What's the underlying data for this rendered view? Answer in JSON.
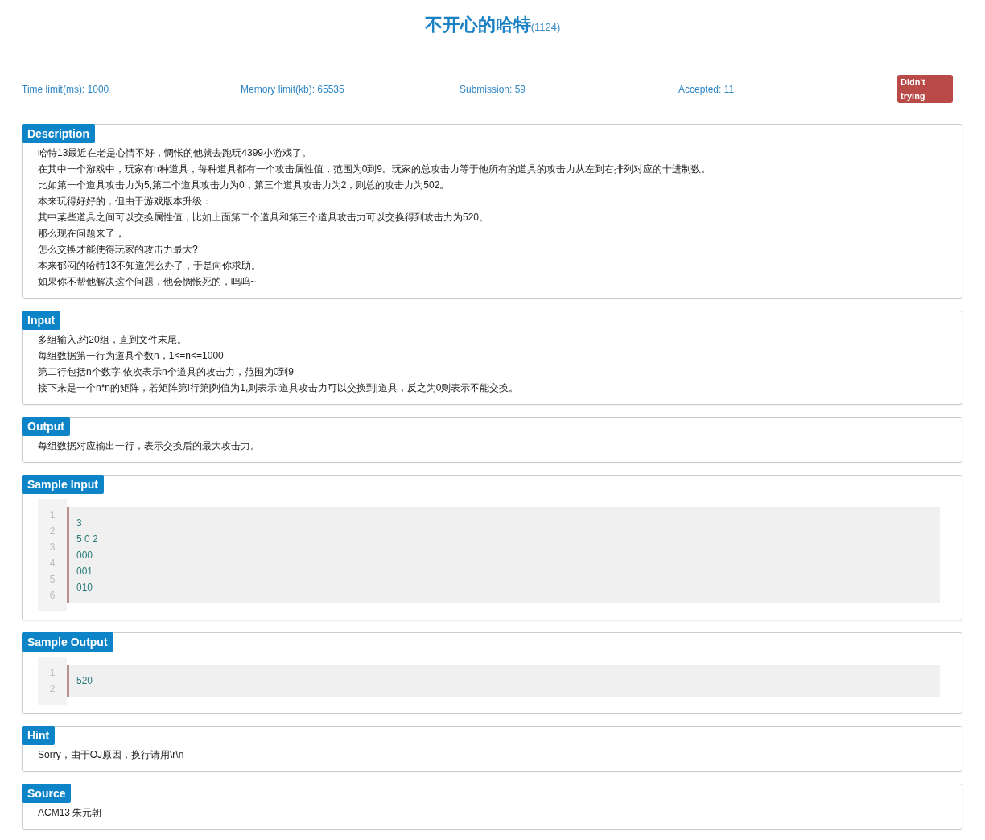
{
  "problem": {
    "title": "不开心的哈特",
    "id": "(1124)"
  },
  "stats": [
    {
      "label": "Time limit(ms): 1000"
    },
    {
      "label": "Memory limit(kb): 65535"
    },
    {
      "label": "Submission: 59"
    },
    {
      "label": "Accepted: 11"
    }
  ],
  "status": {
    "label": "Didn't trying"
  },
  "sections": [
    {
      "kind": "text",
      "heading": "Description",
      "lines": [
        "哈特13最近在老是心情不好，惆怅的他就去跑玩4399小游戏了。",
        "在其中一个游戏中，玩家有n种道具，每种道具都有一个攻击属性值，范围为0到9。玩家的总攻击力等于他所有的道具的攻击力从左到右排列对应的十进制数。",
        "比如第一个道具攻击力为5,第二个道具攻击力为0，第三个道具攻击力为2，则总的攻击力为502。",
        "本来玩得好好的，但由于游戏版本升级：",
        "其中某些道具之间可以交换属性值，比如上面第二个道具和第三个道具攻击力可以交换得到攻击力为520。",
        "那么现在问题来了，",
        "怎么交换才能使得玩家的攻击力最大?",
        "本来郁闷的哈特13不知道怎么办了，于是向你求助。",
        "如果你不帮他解决这个问题，他会惆怅死的，呜呜~"
      ]
    },
    {
      "kind": "text",
      "heading": "Input",
      "lines": [
        "多组输入,约20组，直到文件末尾。",
        "每组数据第一行为道具个数n，1<=n<=1000",
        "第二行包括n个数字,依次表示n个道具的攻击力，范围为0到9",
        "接下来是一个n*n的矩阵，若矩阵第i行第j列值为1,则表示i道具攻击力可以交换到j道具，反之为0则表示不能交换。"
      ]
    },
    {
      "kind": "text",
      "heading": "Output",
      "lines": [
        "每组数据对应输出一行，表示交换后的最大攻击力。"
      ]
    },
    {
      "kind": "code",
      "heading": "Sample Input",
      "line_numbers": [
        "1",
        "2",
        "3",
        "4",
        "5",
        "6"
      ],
      "lines": [
        "3",
        "5 0 2",
        "000",
        "001",
        "010"
      ]
    },
    {
      "kind": "code",
      "heading": "Sample Output",
      "line_numbers": [
        "1",
        "2"
      ],
      "lines": [
        "520"
      ]
    },
    {
      "kind": "text",
      "heading": "Hint",
      "lines": [
        "Sorry，由于OJ原因，换行请用\\r\\n"
      ]
    },
    {
      "kind": "text",
      "heading": "Source",
      "lines": [
        "ACM13 朱元朝"
      ]
    }
  ]
}
